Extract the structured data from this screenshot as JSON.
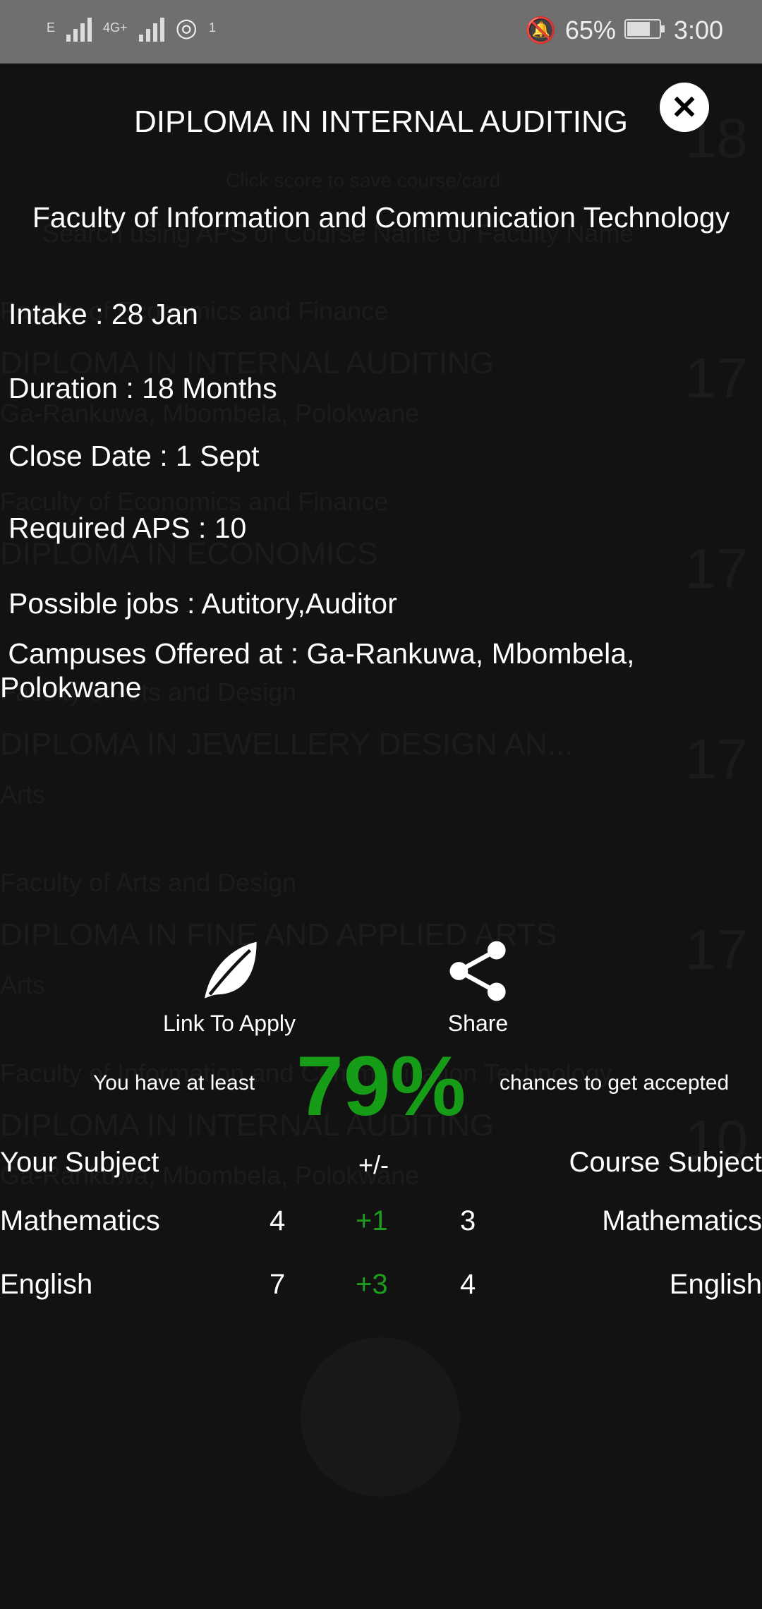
{
  "status_bar": {
    "network_labels": [
      "E",
      "4G+"
    ],
    "hotspot_count": "1",
    "battery": "65%",
    "time": "3:00"
  },
  "background": {
    "ghost_texts": [
      "Click score to save course/card",
      "Search using APS or Course Name or Faculty Name",
      "Faculty of Economics and Finance",
      "DIPLOMA IN INTERNAL AUDITING",
      "Ga-Rankuwa, Mbombela, Polokwane",
      "Faculty of Economics and Finance",
      "DIPLOMA IN ECONOMICS",
      "Faculty of Arts and Design",
      "DIPLOMA IN JEWELLERY DESIGN AN...",
      "Arts",
      "Faculty of Arts and Design",
      "DIPLOMA IN FINE AND APPLIED ARTS",
      "Arts",
      "Faculty of Information and Communication Technology",
      "DIPLOMA IN INTERNAL AUDITING",
      "Ga-Rankuwa, Mbombela, Polokwane"
    ],
    "ghost_numbers": [
      "18",
      "17",
      "17",
      "17",
      "17",
      "10"
    ]
  },
  "modal": {
    "title": "DIPLOMA IN INTERNAL AUDITING",
    "faculty": "Faculty of Information and Communication Technology",
    "intake": "Intake : 28 Jan",
    "duration": "Duration : 18 Months",
    "close_date": "Close Date : 1 Sept",
    "required_aps": "Required APS : 10",
    "possible_jobs": "Possible jobs : Autitory,Auditor",
    "campuses": "Campuses Offered at : Ga-Rankuwa, Mbombela, Polokwane",
    "link_to_apply": "Link To Apply",
    "share": "Share",
    "chance_prefix": "You have at least",
    "chance_percent": "79%",
    "chance_suffix": "chances to get accepted",
    "table": {
      "col_your_subject": "Your Subject",
      "col_diff": "+/-",
      "col_course_subject": "Course Subject",
      "rows": [
        {
          "subject": "Mathematics",
          "your_score": "4",
          "diff": "+1",
          "course_score": "3",
          "course_subject": "Mathematics"
        },
        {
          "subject": "English",
          "your_score": "7",
          "diff": "+3",
          "course_score": "4",
          "course_subject": "English"
        }
      ]
    }
  },
  "colors": {
    "accent_green": "#169c16",
    "overlay": "#111111",
    "status_bar": "#6f6f6f"
  }
}
